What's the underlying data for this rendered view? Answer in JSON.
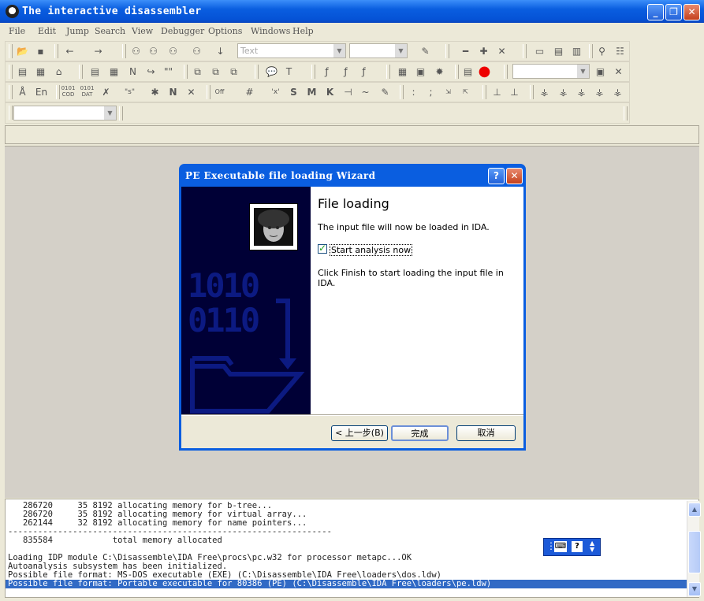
{
  "app": {
    "title": "The interactive disassembler"
  },
  "menu": [
    "File",
    "Edit",
    "Jump",
    "Search",
    "View",
    "Debugger",
    "Options",
    "Windows",
    "Help"
  ],
  "toolbar": {
    "text_combo": "Text",
    "row3_icons": [
      "0101\nCOD",
      "0101\nDAT"
    ],
    "labels": {
      "en": "En",
      "off": "Off",
      "s": "S",
      "m": "M",
      "k": "K",
      "n": "N",
      "str": "\"s\""
    }
  },
  "dialog": {
    "title": "PE Executable file loading Wizard",
    "heading": "File loading",
    "desc": "The input file will now be loaded in IDA.",
    "checkbox_label": "Start analysis now",
    "checkbox_checked": true,
    "hint": "Click Finish to start loading the input file in IDA.",
    "art_text": [
      "1010",
      "0110"
    ],
    "buttons": {
      "back": "< 上一步(B)",
      "finish": "完成",
      "cancel": "取消"
    }
  },
  "log": {
    "lines": [
      "   286720     35 8192 allocating memory for b-tree...",
      "   286720     35 8192 allocating memory for virtual array...",
      "   262144     32 8192 allocating memory for name pointers...",
      "-----------------------------------------------------------------",
      "   835584            total memory allocated",
      "",
      "Loading IDP module C:\\Disassemble\\IDA Free\\procs\\pc.w32 for processor metapc...OK",
      "Autoanalysis subsystem has been initialized.",
      "Possible file format: MS-DOS executable (EXE) (C:\\Disassemble\\IDA Free\\loaders\\dos.ldw)",
      "Possible file format: Portable executable for 80386 (PE) (C:\\Disassemble\\IDA Free\\loaders\\pe.ldw)"
    ],
    "selected_line": 9
  },
  "colors": {
    "xp_blue": "#0a5ee0",
    "wizard_art": "#000036",
    "selection": "#316ac5"
  }
}
